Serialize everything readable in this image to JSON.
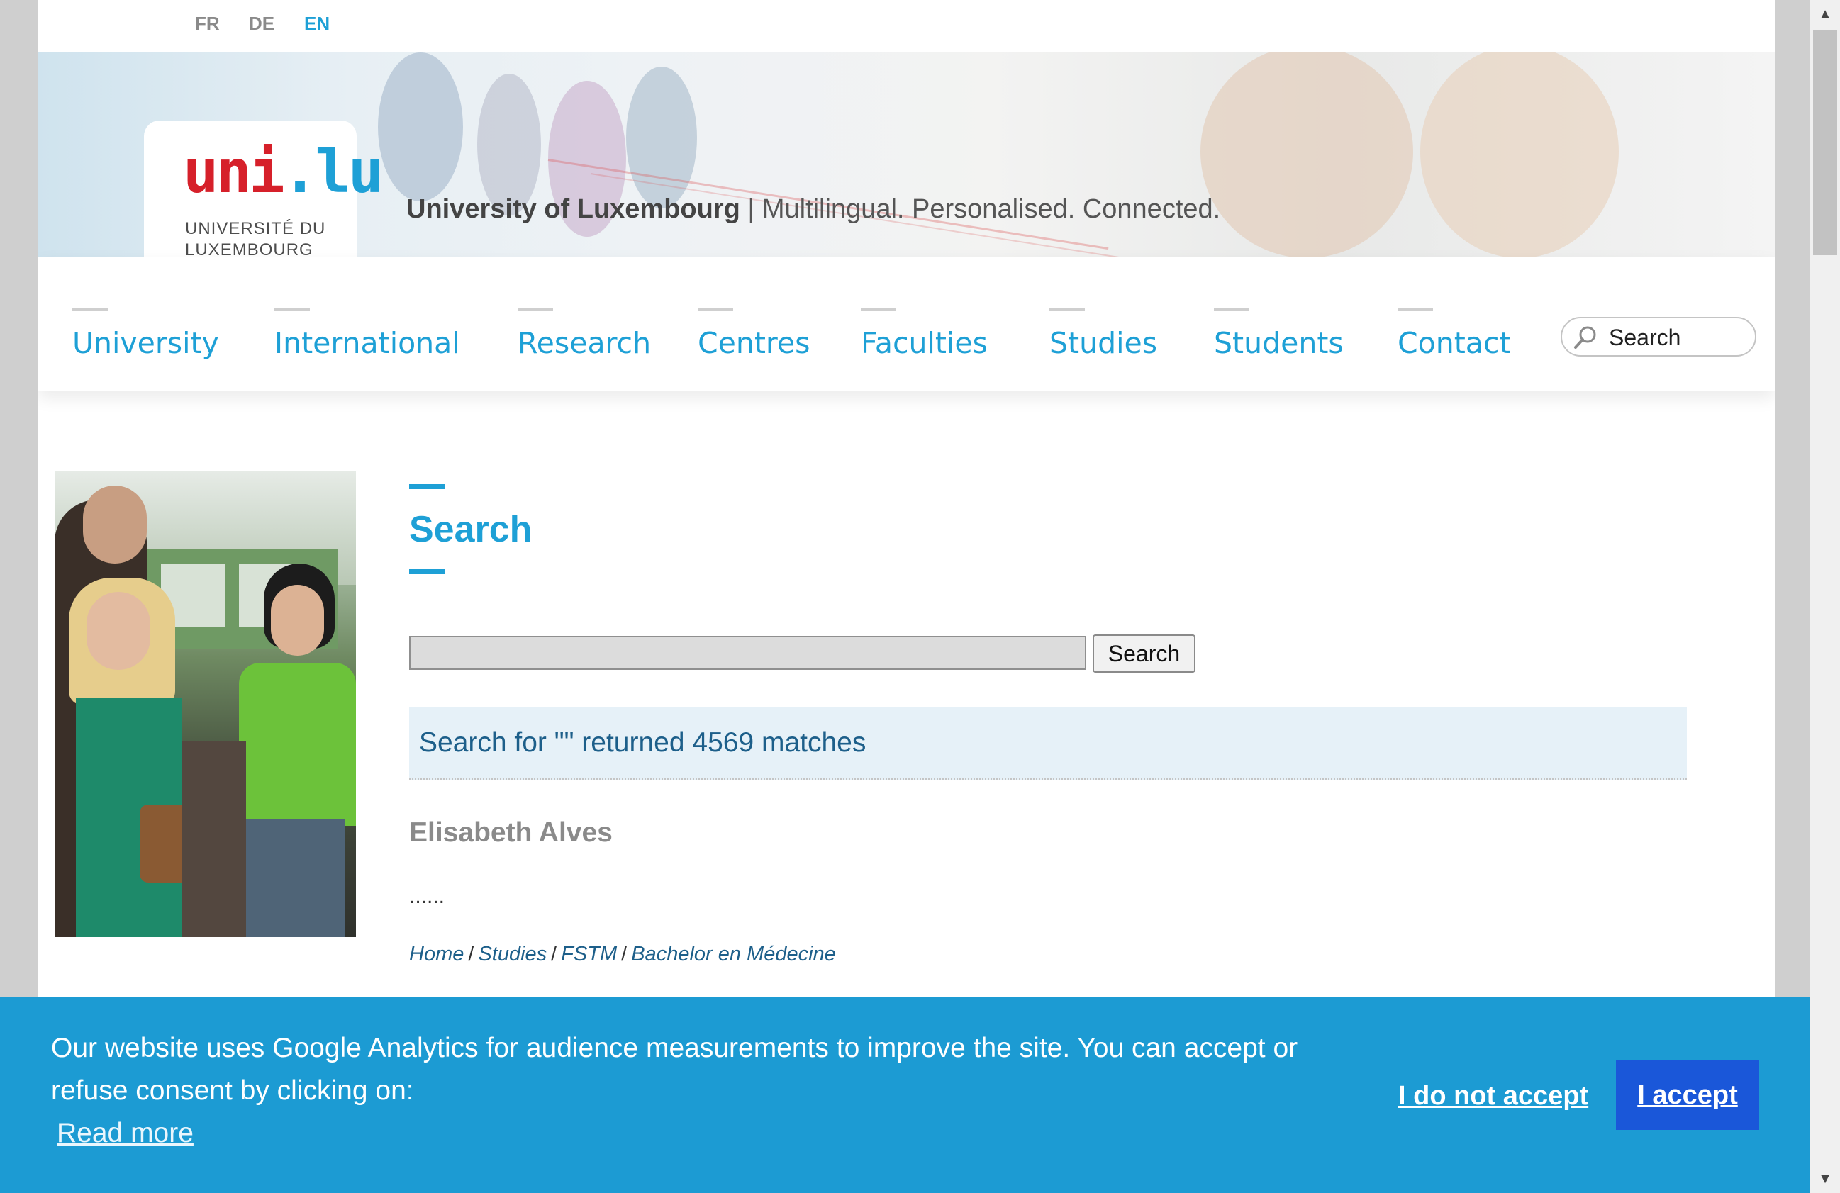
{
  "languages": [
    {
      "code": "FR",
      "active": false
    },
    {
      "code": "DE",
      "active": false
    },
    {
      "code": "EN",
      "active": true
    }
  ],
  "banner": {
    "logo_mark_red": "uni",
    "logo_mark_blue": ".lu",
    "logo_line1": "UNIVERSITÉ DU",
    "logo_line2": "LUXEMBOURG",
    "tagline_bold": "University of Luxembourg",
    "tagline_rest": " | Multilingual. Personalised. Connected."
  },
  "nav": {
    "items": [
      "University",
      "International",
      "Research",
      "Centres",
      "Faculties",
      "Studies",
      "Students",
      "Contact"
    ],
    "search_placeholder": "Search",
    "search_icon": "magnifier-icon"
  },
  "content": {
    "title": "Search",
    "search_input_value": "",
    "search_button": "Search",
    "summary": "Search for \"\" returned 4569 matches",
    "results": [
      {
        "title": "Elisabeth Alves",
        "snippet": "......",
        "breadcrumb": [
          "Home",
          "Studies",
          "FSTM",
          "Bachelor en Médecine"
        ]
      }
    ]
  },
  "cookie": {
    "message": "Our website uses Google Analytics for audience measurements to improve the site. You can accept or refuse consent by clicking on:",
    "read_more": "Read more",
    "decline": "I do not accept",
    "accept": "I accept"
  },
  "colors": {
    "brand_blue": "#1ea0d6",
    "brand_red": "#d6202a",
    "cookie_bg": "#1c9bd3",
    "accept_bg": "#1a57d9"
  }
}
